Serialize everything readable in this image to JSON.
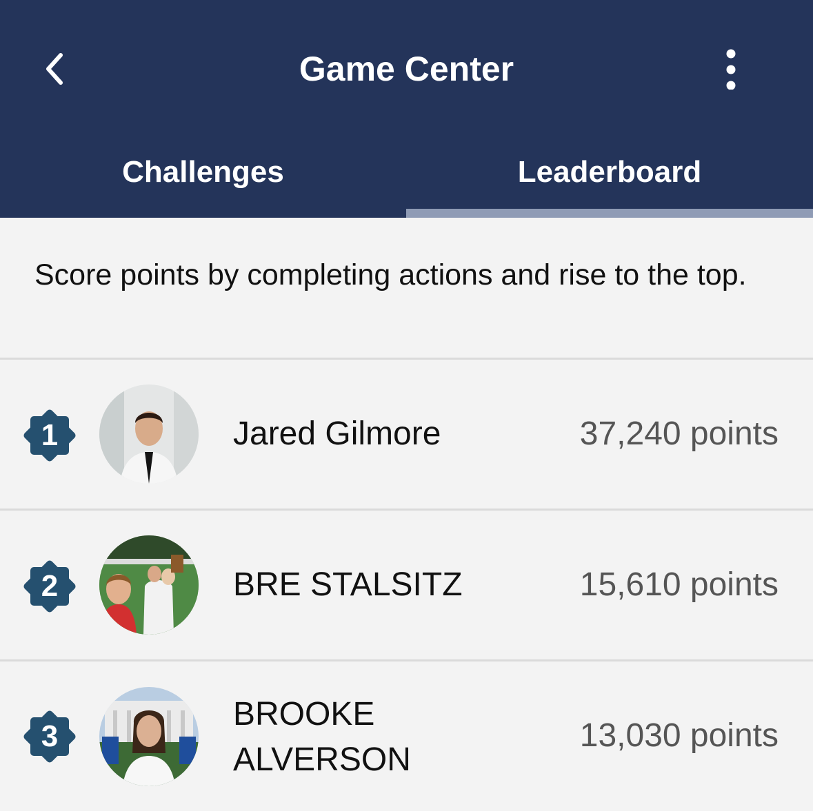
{
  "header": {
    "title": "Game Center",
    "back_icon": "chevron-left-icon",
    "more_icon": "more-vertical-icon"
  },
  "tabs": [
    {
      "label": "Challenges",
      "selected": false
    },
    {
      "label": "Leaderboard",
      "selected": true
    }
  ],
  "intro": "Score points by completing actions and rise to the top.",
  "leaderboard": [
    {
      "rank": "1",
      "name": "Jared Gilmore",
      "points": "37,240 points"
    },
    {
      "rank": "2",
      "name": "BRE STALSITZ",
      "points": "15,610 points"
    },
    {
      "rank": "3",
      "name": "BROOKE ALVERSON",
      "points": "13,030 points"
    }
  ],
  "colors": {
    "header_bg": "#24345a",
    "badge": "#25506f",
    "tab_indicator": "#8f9bb5",
    "page_bg": "#f3f3f3"
  }
}
